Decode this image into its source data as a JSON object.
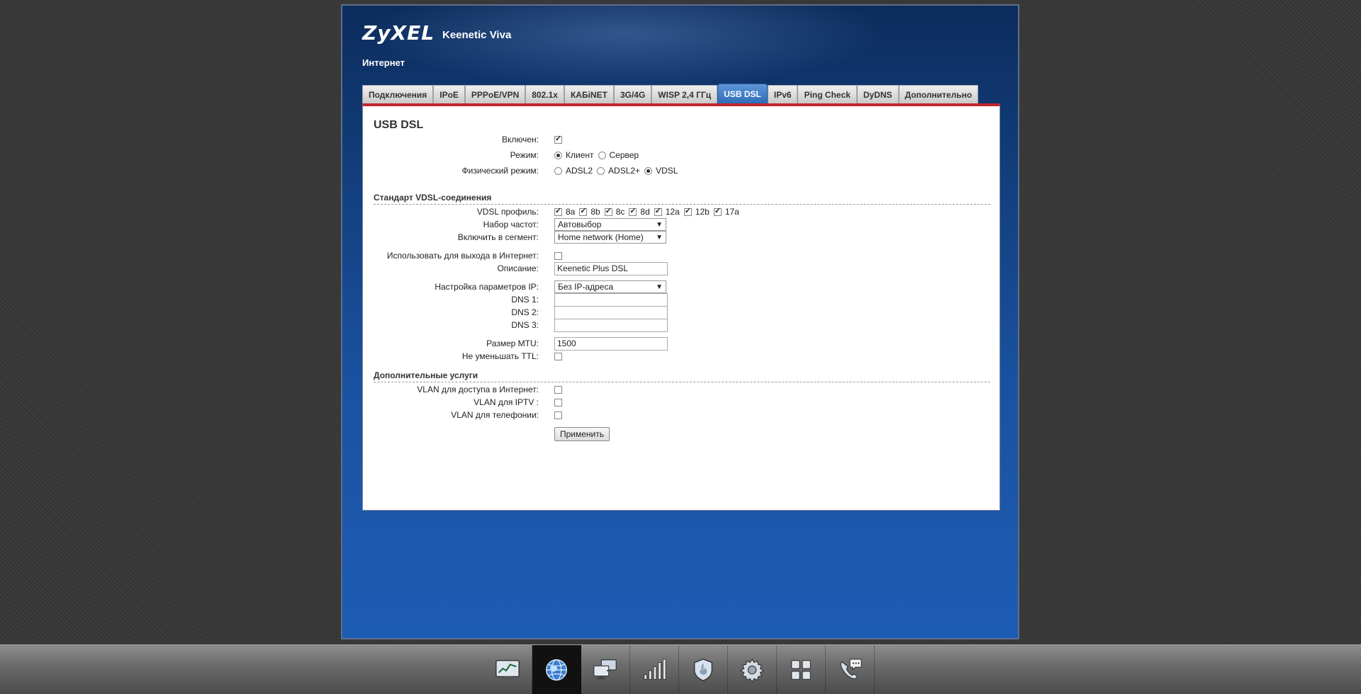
{
  "header": {
    "brand": "ZyXEL",
    "model": "Keenetic Viva",
    "section": "Интернет"
  },
  "tabs": [
    {
      "label": "Подключения",
      "active": false
    },
    {
      "label": "IPoE",
      "active": false
    },
    {
      "label": "PPPoE/VPN",
      "active": false
    },
    {
      "label": "802.1x",
      "active": false
    },
    {
      "label": "КАБiNET",
      "active": false
    },
    {
      "label": "3G/4G",
      "active": false
    },
    {
      "label": "WISP 2,4 ГГц",
      "active": false
    },
    {
      "label": "USB DSL",
      "active": true
    },
    {
      "label": "IPv6",
      "active": false
    },
    {
      "label": "Ping Check",
      "active": false
    },
    {
      "label": "DyDNS",
      "active": false
    },
    {
      "label": "Дополнительно",
      "active": false
    }
  ],
  "form": {
    "title": "USB DSL",
    "enabled": {
      "label": "Включен:",
      "checked": true
    },
    "mode": {
      "label": "Режим:",
      "client": "Клиент",
      "server": "Сервер",
      "selected": "client"
    },
    "phys_mode": {
      "label": "Физический режим:",
      "adsl2": "ADSL2",
      "adsl2plus": "ADSL2+",
      "vdsl": "VDSL",
      "selected": "vdsl"
    },
    "vdsl_standard_heading": "Стандарт VDSL-соединения",
    "vdsl_profile": {
      "label": "VDSL профиль:",
      "items": [
        "8a",
        "8b",
        "8c",
        "8d",
        "12a",
        "12b",
        "17a"
      ]
    },
    "freq_set": {
      "label": "Набор частот:",
      "value": "Автовыбор"
    },
    "segment": {
      "label": "Включить в сегмент:",
      "value": "Home network (Home)"
    },
    "use_for_internet": {
      "label": "Использовать для выхода в Интернет:",
      "checked": false
    },
    "description": {
      "label": "Описание:",
      "value": "Keenetic Plus DSL"
    },
    "ip_settings": {
      "label": "Настройка параметров IP:",
      "value": "Без IP-адреса"
    },
    "dns1": {
      "label": "DNS 1:",
      "value": ""
    },
    "dns2": {
      "label": "DNS 2:",
      "value": ""
    },
    "dns3": {
      "label": "DNS 3:",
      "value": ""
    },
    "mtu": {
      "label": "Размер MTU:",
      "value": "1500"
    },
    "no_ttl": {
      "label": "Не уменьшать TTL:",
      "checked": false
    },
    "extra_heading": "Дополнительные услуги",
    "vlan_internet": {
      "label": "VLAN для доступа в Интернет:"
    },
    "vlan_iptv": {
      "label": "VLAN для IPTV :"
    },
    "vlan_phone": {
      "label": "VLAN для телефонии:"
    },
    "apply_label": "Применить"
  },
  "dock": [
    {
      "icon": "monitor-chart-icon"
    },
    {
      "icon": "globe-icon",
      "active": true
    },
    {
      "icon": "computers-icon"
    },
    {
      "icon": "signal-bars-icon"
    },
    {
      "icon": "shield-icon"
    },
    {
      "icon": "gear-icon"
    },
    {
      "icon": "apps-grid-icon"
    },
    {
      "icon": "phone-chat-icon"
    }
  ]
}
